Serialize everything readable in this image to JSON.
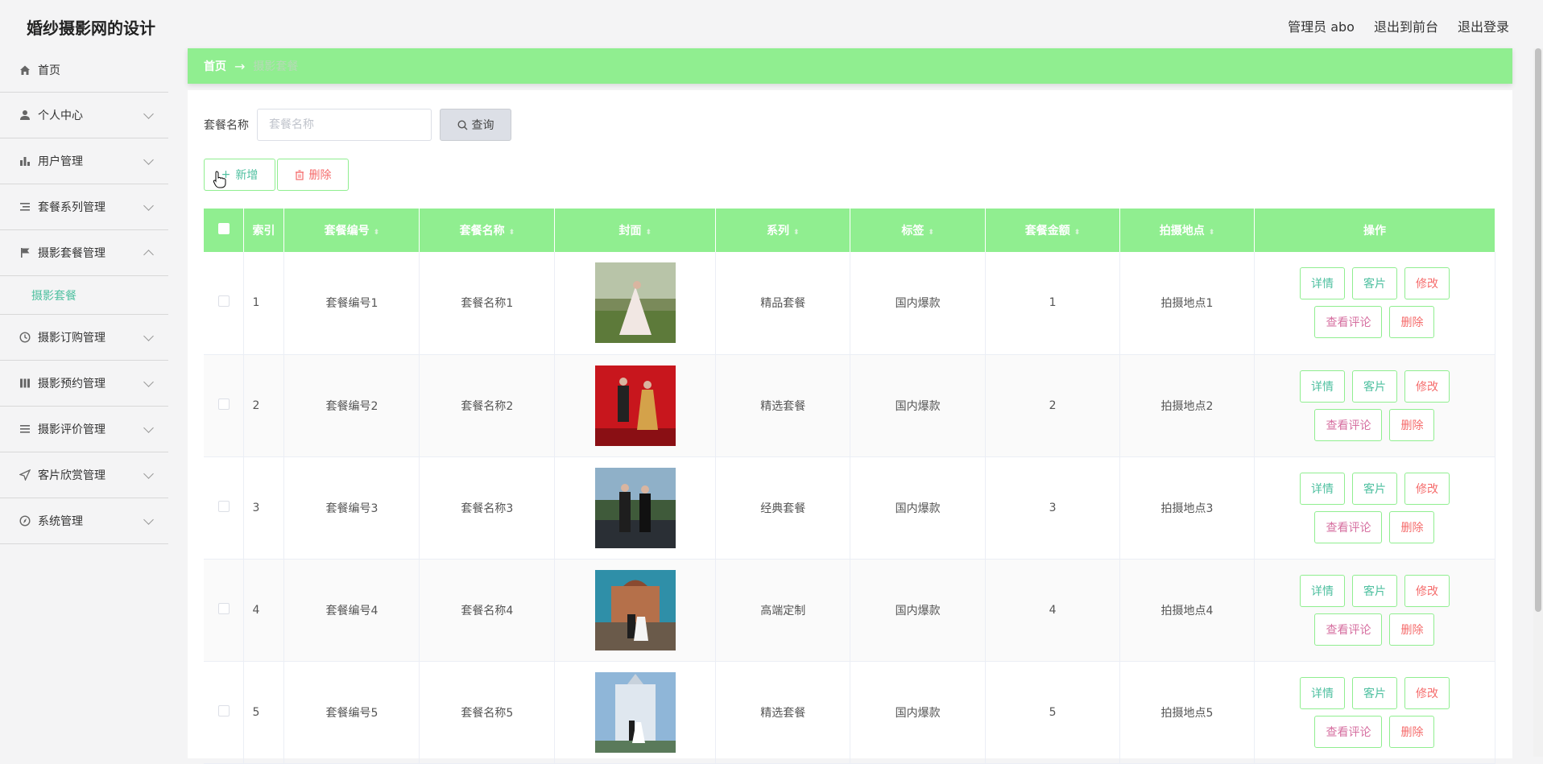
{
  "header": {
    "title": "婚纱摄影网的设计",
    "user": "管理员 abo",
    "to_front": "退出到前台",
    "logout": "退出登录"
  },
  "sidebar": {
    "items": [
      {
        "label": "首页",
        "icon": "home-icon"
      },
      {
        "label": "个人中心",
        "icon": "user-icon"
      },
      {
        "label": "用户管理",
        "icon": "bar-chart-icon"
      },
      {
        "label": "套餐系列管理",
        "icon": "list-icon"
      },
      {
        "label": "摄影套餐管理",
        "icon": "flag-icon",
        "expanded": true
      },
      {
        "label": "摄影订购管理",
        "icon": "clock-icon"
      },
      {
        "label": "摄影预约管理",
        "icon": "columns-icon"
      },
      {
        "label": "摄影评价管理",
        "icon": "menu-icon"
      },
      {
        "label": "客片欣赏管理",
        "icon": "send-icon"
      },
      {
        "label": "系统管理",
        "icon": "compass-icon"
      }
    ],
    "active_sub": "摄影套餐"
  },
  "breadcrumb": {
    "home": "首页",
    "arrow": "→",
    "current": "摄影套餐"
  },
  "search": {
    "label": "套餐名称",
    "placeholder": "套餐名称",
    "button": "查询"
  },
  "actions": {
    "add": "新增",
    "delete": "删除"
  },
  "table": {
    "headers": [
      "索引",
      "套餐编号",
      "套餐名称",
      "封面",
      "系列",
      "标签",
      "套餐金额",
      "拍摄地点",
      "操作"
    ],
    "rows": [
      {
        "index": "1",
        "code": "套餐编号1",
        "name": "套餐名称1",
        "series": "精品套餐",
        "tag": "国内爆款",
        "price": "1",
        "place": "拍摄地点1"
      },
      {
        "index": "2",
        "code": "套餐编号2",
        "name": "套餐名称2",
        "series": "精选套餐",
        "tag": "国内爆款",
        "price": "2",
        "place": "拍摄地点2"
      },
      {
        "index": "3",
        "code": "套餐编号3",
        "name": "套餐名称3",
        "series": "经典套餐",
        "tag": "国内爆款",
        "price": "3",
        "place": "拍摄地点3"
      },
      {
        "index": "4",
        "code": "套餐编号4",
        "name": "套餐名称4",
        "series": "高端定制",
        "tag": "国内爆款",
        "price": "4",
        "place": "拍摄地点4"
      },
      {
        "index": "5",
        "code": "套餐编号5",
        "name": "套餐名称5",
        "series": "精选套餐",
        "tag": "国内爆款",
        "price": "5",
        "place": "拍摄地点5"
      }
    ],
    "row_ops": {
      "detail": "详情",
      "photos": "客片",
      "edit": "修改",
      "comments": "查看评论",
      "delete": "删除"
    }
  },
  "colors": {
    "accent_green": "#90ee90",
    "teal_text": "#4fc0a0",
    "danger": "#f56c6c"
  }
}
